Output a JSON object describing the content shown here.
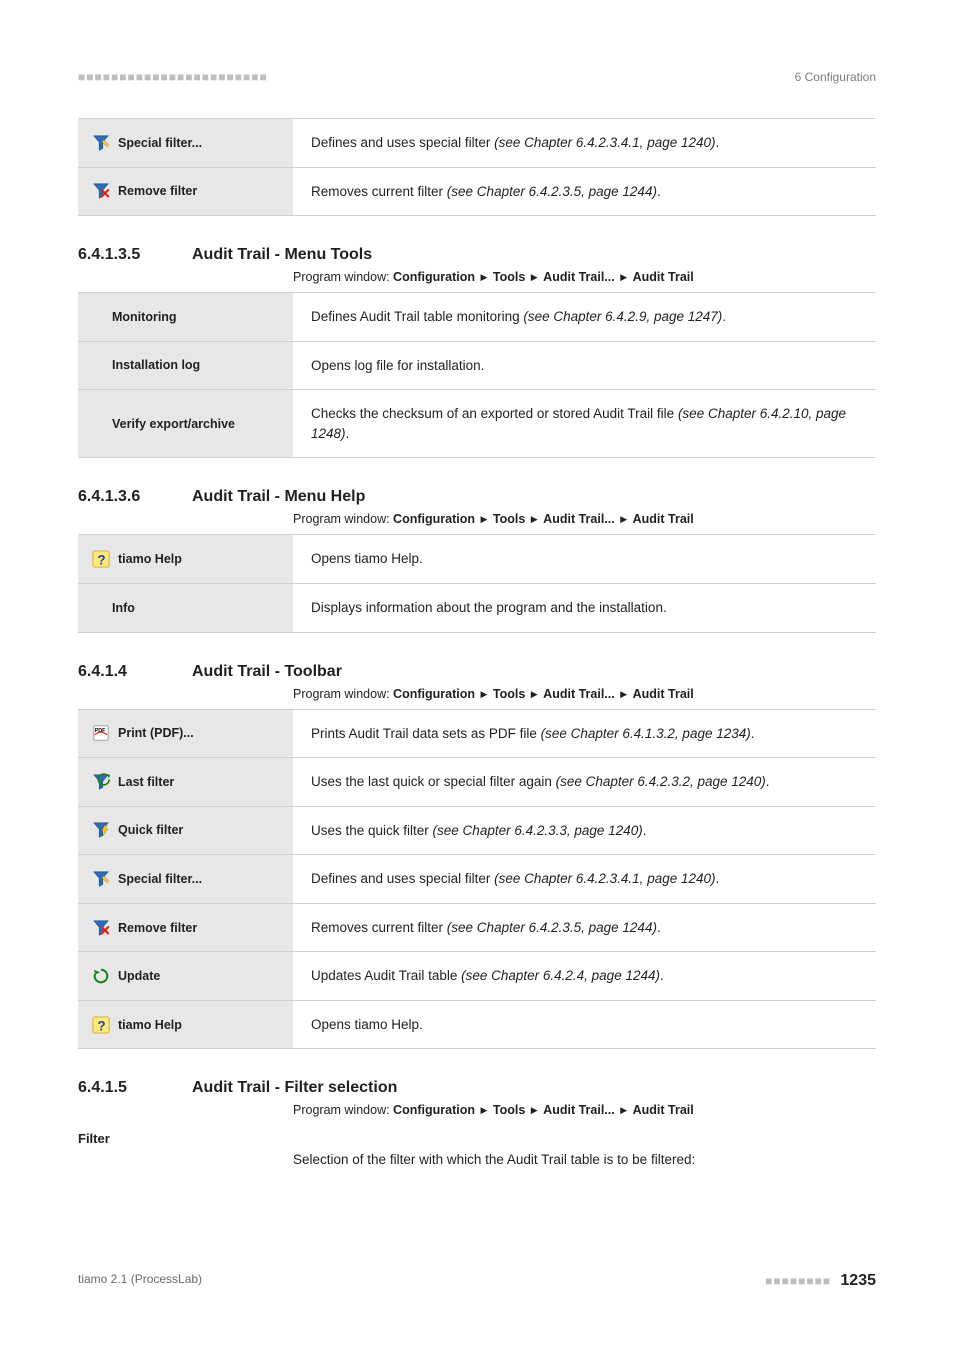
{
  "header_left": "■■■■■■■■■■■■■■■■■■■■■■■",
  "header_right": "6 Configuration",
  "pre_rows": [
    {
      "icon": "funnel-edit",
      "label": "Special filter...",
      "desc_pre": "Defines and uses special filter ",
      "desc_em": "(see Chapter 6.4.2.3.4.1, page 1240)",
      "desc_post": "."
    },
    {
      "icon": "funnel-x",
      "label": "Remove filter",
      "desc_pre": "Removes current filter ",
      "desc_em": "(see Chapter 6.4.2.3.5, page 1244)",
      "desc_post": "."
    }
  ],
  "sec_tools_num": "6.4.1.3.5",
  "sec_tools_title": "Audit Trail - Menu Tools",
  "crumb_prefix": "Program window: ",
  "crumb_parts": [
    "Configuration",
    "Tools",
    "Audit Trail...",
    "Audit Trail"
  ],
  "tools_rows": [
    {
      "label": "Monitoring",
      "desc_pre": "Defines Audit Trail table monitoring ",
      "desc_em": "(see Chapter 6.4.2.9, page 1247)",
      "desc_post": "."
    },
    {
      "label": "Installation log",
      "desc_pre": "Opens log file for installation.",
      "desc_em": "",
      "desc_post": ""
    },
    {
      "label": "Verify export/archive",
      "desc_pre": "Checks the checksum of an exported or stored Audit Trail file ",
      "desc_em": "(see Chapter 6.4.2.10, page 1248)",
      "desc_post": "."
    }
  ],
  "sec_help_num": "6.4.1.3.6",
  "sec_help_title": "Audit Trail - Menu Help",
  "help_rows": [
    {
      "icon": "help",
      "label": "tiamo Help",
      "desc_pre": "Opens tiamo Help.",
      "desc_em": "",
      "desc_post": ""
    },
    {
      "icon": "",
      "label": "Info",
      "desc_pre": "Displays information about the program and the installation.",
      "desc_em": "",
      "desc_post": ""
    }
  ],
  "sec_toolbar_num": "6.4.1.4",
  "sec_toolbar_title": "Audit Trail - Toolbar",
  "toolbar_rows": [
    {
      "icon": "pdf",
      "label": "Print (PDF)...",
      "desc_pre": "Prints Audit Trail data sets as PDF file ",
      "desc_em": "(see Chapter 6.4.1.3.2, page 1234)",
      "desc_post": "."
    },
    {
      "icon": "funnel-back",
      "label": "Last filter",
      "desc_pre": "Uses the last quick or special filter again ",
      "desc_em": "(see Chapter 6.4.2.3.2, page 1240)",
      "desc_post": "."
    },
    {
      "icon": "funnel-flash",
      "label": "Quick filter",
      "desc_pre": "Uses the quick filter ",
      "desc_em": "(see Chapter 6.4.2.3.3, page 1240)",
      "desc_post": "."
    },
    {
      "icon": "funnel-edit",
      "label": "Special filter...",
      "desc_pre": "Defines and uses special filter ",
      "desc_em": "(see Chapter 6.4.2.3.4.1, page 1240)",
      "desc_post": "."
    },
    {
      "icon": "funnel-x",
      "label": "Remove filter",
      "desc_pre": "Removes current filter ",
      "desc_em": "(see Chapter 6.4.2.3.5, page 1244)",
      "desc_post": "."
    },
    {
      "icon": "refresh",
      "label": "Update",
      "desc_pre": "Updates Audit Trail table ",
      "desc_em": "(see Chapter 6.4.2.4, page 1244)",
      "desc_post": "."
    },
    {
      "icon": "help",
      "label": "tiamo Help",
      "desc_pre": "Opens tiamo Help.",
      "desc_em": "",
      "desc_post": ""
    }
  ],
  "sec_filtersel_num": "6.4.1.5",
  "sec_filtersel_title": "Audit Trail - Filter selection",
  "filter_label": "Filter",
  "filter_body": "Selection of the filter with which the Audit Trail table is to be filtered:",
  "footer_left": "tiamo 2.1 (ProcessLab)",
  "footer_dots": "■■■■■■■■",
  "footer_page": "1235"
}
